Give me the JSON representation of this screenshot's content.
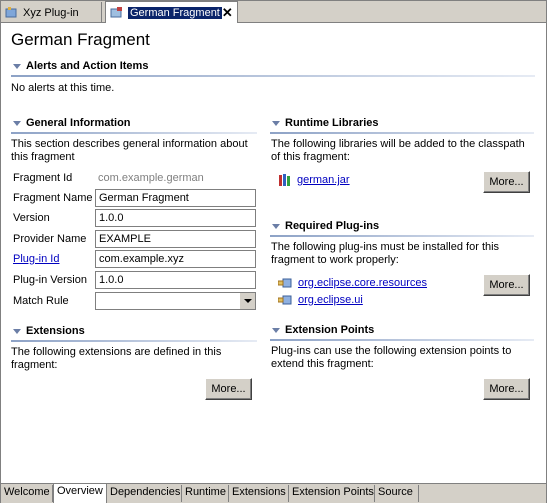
{
  "tabs": [
    {
      "label": "Xyz Plug-in"
    },
    {
      "label": "German Fragment"
    }
  ],
  "page_title": "German Fragment",
  "alerts": {
    "title": "Alerts and Action Items",
    "text": "No alerts at this time."
  },
  "general": {
    "title": "General Information",
    "desc": "This section describes general information about this fragment",
    "fragment_id_label": "Fragment Id",
    "fragment_id_value": "com.example.german",
    "fragment_name_label": "Fragment Name",
    "fragment_name_value": "German Fragment",
    "version_label": "Version",
    "version_value": "1.0.0",
    "provider_label": "Provider Name",
    "provider_value": "EXAMPLE",
    "plugin_id_label": "Plug-in Id",
    "plugin_id_value": "com.example.xyz",
    "plugin_version_label": "Plug-in Version",
    "plugin_version_value": "1.0.0",
    "match_rule_label": "Match Rule",
    "match_rule_value": ""
  },
  "extensions": {
    "title": "Extensions",
    "desc": "The following extensions are defined in this fragment:",
    "more": "More..."
  },
  "runtime": {
    "title": "Runtime Libraries",
    "desc": "The following libraries will be added to the classpath of this fragment:",
    "items": [
      "german.jar"
    ],
    "more": "More..."
  },
  "required": {
    "title": "Required Plug-ins",
    "desc": "The following plug-ins must be installed for this fragment to work properly:",
    "items": [
      "org.eclipse.core.resources",
      "org.eclipse.ui"
    ],
    "more": "More..."
  },
  "points": {
    "title": "Extension Points",
    "desc": "Plug-ins can use the following extension points to extend this fragment:",
    "more": "More..."
  },
  "bottom_tabs": [
    "Welcome",
    "Overview",
    "Dependencies",
    "Runtime",
    "Extensions",
    "Extension Points",
    "Source"
  ],
  "colors": {
    "link": "#0000c0",
    "selection": "#0a246a",
    "chrome": "#d4d0c8"
  }
}
